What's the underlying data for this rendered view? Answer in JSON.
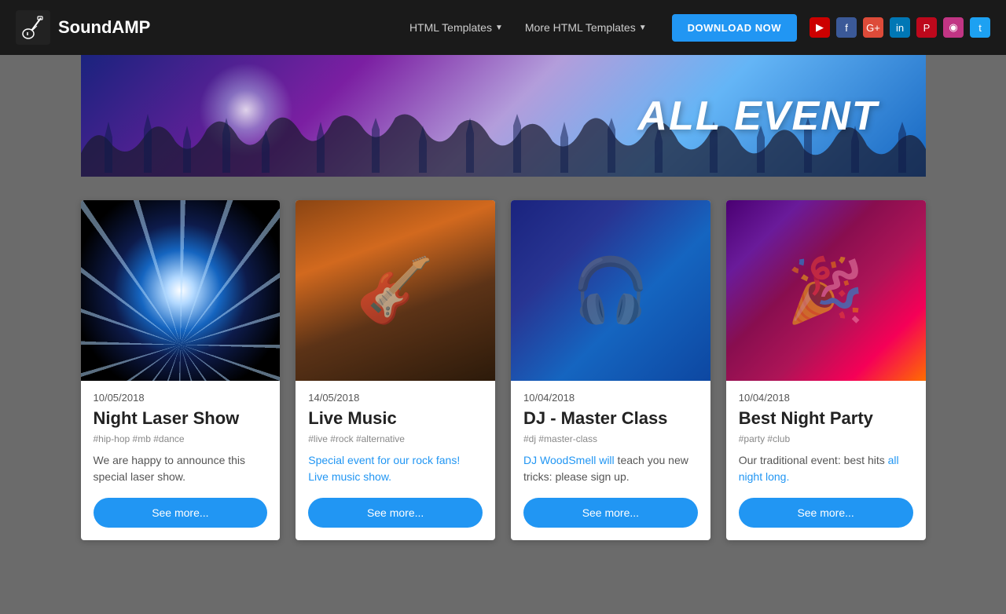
{
  "brand": {
    "name": "SoundAMP"
  },
  "navbar": {
    "nav1_label": "HTML Templates",
    "nav2_label": "More HTML Templates",
    "download_label": "DOWNLOAD NOW"
  },
  "social": [
    {
      "id": "youtube",
      "class": "si-youtube",
      "symbol": "▶"
    },
    {
      "id": "facebook",
      "class": "si-facebook",
      "symbol": "f"
    },
    {
      "id": "google",
      "class": "si-google",
      "symbol": "G"
    },
    {
      "id": "linkedin",
      "class": "si-linkedin",
      "symbol": "in"
    },
    {
      "id": "pinterest",
      "class": "si-pinterest",
      "symbol": "P"
    },
    {
      "id": "instagram",
      "class": "si-instagram",
      "symbol": "◉"
    },
    {
      "id": "twitter",
      "class": "si-twitter",
      "symbol": "t"
    }
  ],
  "hero": {
    "title": "ALL EVENT"
  },
  "cards": [
    {
      "date": "10/05/2018",
      "title": "Night Laser Show",
      "tags": "#hip-hop #mb #dance",
      "description": "We are happy to announce this special laser show.",
      "btn_label": "See more...",
      "img_class": "img-laser"
    },
    {
      "date": "14/05/2018",
      "title": "Live Music",
      "tags": "#live #rock #alternative",
      "description": "Special event for our rock fans! Live music show.",
      "btn_label": "See more...",
      "img_class": "img-music",
      "desc_is_link": true
    },
    {
      "date": "10/04/2018",
      "title": "DJ - Master Class",
      "tags": "#dj #master-class",
      "description": "DJ WoodSmell will teach you new tricks: please sign up.",
      "btn_label": "See more...",
      "img_class": "img-dj",
      "highlight": "DJ WoodSmell will"
    },
    {
      "date": "10/04/2018",
      "title": "Best Night Party",
      "tags": "#party #club",
      "description": "Our traditional event: best hits all night long.",
      "btn_label": "See more...",
      "img_class": "img-party",
      "has_links": true
    }
  ]
}
